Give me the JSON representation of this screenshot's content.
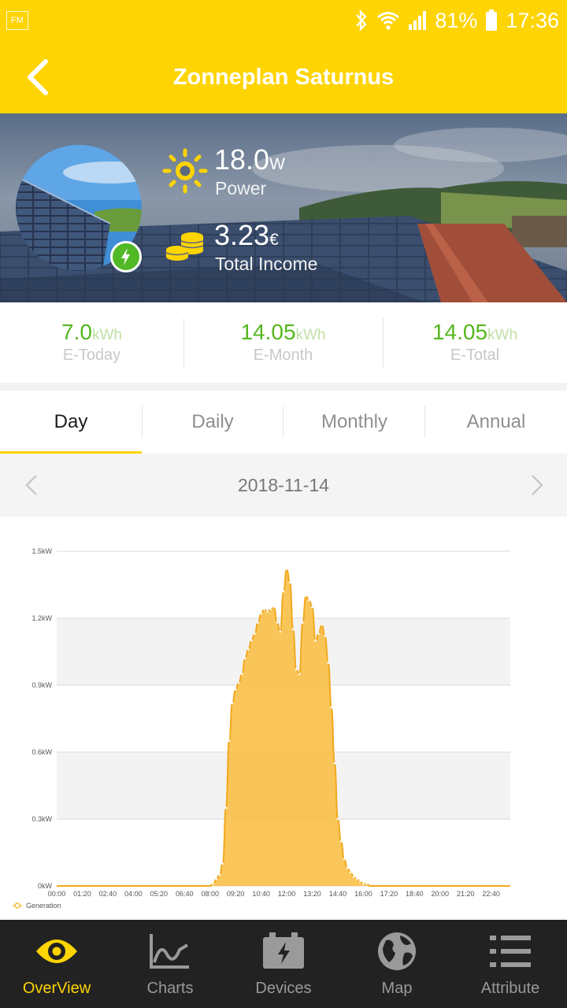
{
  "status_bar": {
    "fm_badge": "FM",
    "battery": "81%",
    "time": "17:36",
    "icons": [
      "bluetooth-icon",
      "wifi-icon",
      "signal-icon",
      "battery-icon"
    ]
  },
  "header": {
    "title": "Zonneplan Saturnus",
    "back_icon": "back-arrow-icon"
  },
  "hero": {
    "power_value": "18.0",
    "power_unit": "W",
    "power_label": "Power",
    "income_value": "3.23",
    "income_unit": "€",
    "income_label": "Total Income",
    "power_icon": "sun-icon",
    "income_icon": "coins-icon",
    "status_icon": "lightning-icon"
  },
  "stats": [
    {
      "value": "7.0",
      "unit": "kWh",
      "label": "E-Today"
    },
    {
      "value": "14.05",
      "unit": "kWh",
      "label": "E-Month"
    },
    {
      "value": "14.05",
      "unit": "kWh",
      "label": "E-Total"
    }
  ],
  "tabs": [
    {
      "label": "Day",
      "active": true
    },
    {
      "label": "Daily",
      "active": false
    },
    {
      "label": "Monthly",
      "active": false
    },
    {
      "label": "Annual",
      "active": false
    }
  ],
  "date_nav": {
    "date": "2018-11-14",
    "prev_icon": "chevron-left-icon",
    "next_icon": "chevron-right-icon"
  },
  "chart_data": {
    "type": "area",
    "title": "",
    "xlabel": "",
    "ylabel": "",
    "ylim": [
      0,
      1.5
    ],
    "xlim": [
      "00:00",
      "23:40"
    ],
    "y_ticks": [
      "0kW",
      "0.3kW",
      "0.6kW",
      "0.9kW",
      "1.2kW",
      "1.5kW"
    ],
    "x_ticks": [
      "00:00",
      "01:20",
      "02:40",
      "04:00",
      "05:20",
      "06:40",
      "08:00",
      "09:20",
      "10:40",
      "12:00",
      "13:20",
      "14:40",
      "16:00",
      "17:20",
      "18:40",
      "20:00",
      "21:20",
      "22:40"
    ],
    "grid": true,
    "legend_position": "bottom-left",
    "color": "#f9bc3c",
    "series": [
      {
        "name": "Generation",
        "x": [
          "00:00",
          "08:00",
          "08:10",
          "08:20",
          "08:30",
          "08:40",
          "08:50",
          "09:00",
          "09:10",
          "09:20",
          "09:30",
          "09:40",
          "09:50",
          "10:00",
          "10:10",
          "10:20",
          "10:30",
          "10:40",
          "10:50",
          "11:00",
          "11:10",
          "11:20",
          "11:30",
          "11:40",
          "11:50",
          "12:00",
          "12:10",
          "12:20",
          "12:30",
          "12:40",
          "12:50",
          "13:00",
          "13:10",
          "13:20",
          "13:30",
          "13:40",
          "13:50",
          "14:00",
          "14:10",
          "14:20",
          "14:30",
          "14:40",
          "14:50",
          "15:00",
          "15:10",
          "15:20",
          "15:30",
          "15:40",
          "15:50",
          "16:00",
          "16:10",
          "16:20",
          "16:30",
          "16:40",
          "16:50",
          "17:00",
          "17:10",
          "17:20",
          "17:30",
          "17:40",
          "23:40"
        ],
        "values": [
          0,
          0,
          0.01,
          0.03,
          0.05,
          0.1,
          0.35,
          0.65,
          0.82,
          0.88,
          0.91,
          0.95,
          1.02,
          1.06,
          1.1,
          1.13,
          1.18,
          1.22,
          1.24,
          1.23,
          1.24,
          1.25,
          1.18,
          1.14,
          1.32,
          1.42,
          1.36,
          1.15,
          0.97,
          0.95,
          1.18,
          1.3,
          1.28,
          1.25,
          1.1,
          1.13,
          1.17,
          1.12,
          1.0,
          0.8,
          0.55,
          0.3,
          0.2,
          0.12,
          0.08,
          0.06,
          0.04,
          0.03,
          0.02,
          0.01,
          0.01,
          0,
          0,
          0,
          0,
          0,
          0,
          0,
          0,
          0,
          0
        ]
      }
    ]
  },
  "bottom_nav": [
    {
      "label": "OverView",
      "icon": "eye-icon",
      "active": true
    },
    {
      "label": "Charts",
      "icon": "line-chart-icon",
      "active": false
    },
    {
      "label": "Devices",
      "icon": "battery-bolt-icon",
      "active": false
    },
    {
      "label": "Map",
      "icon": "globe-icon",
      "active": false
    },
    {
      "label": "Attribute",
      "icon": "list-icon",
      "active": false
    }
  ]
}
